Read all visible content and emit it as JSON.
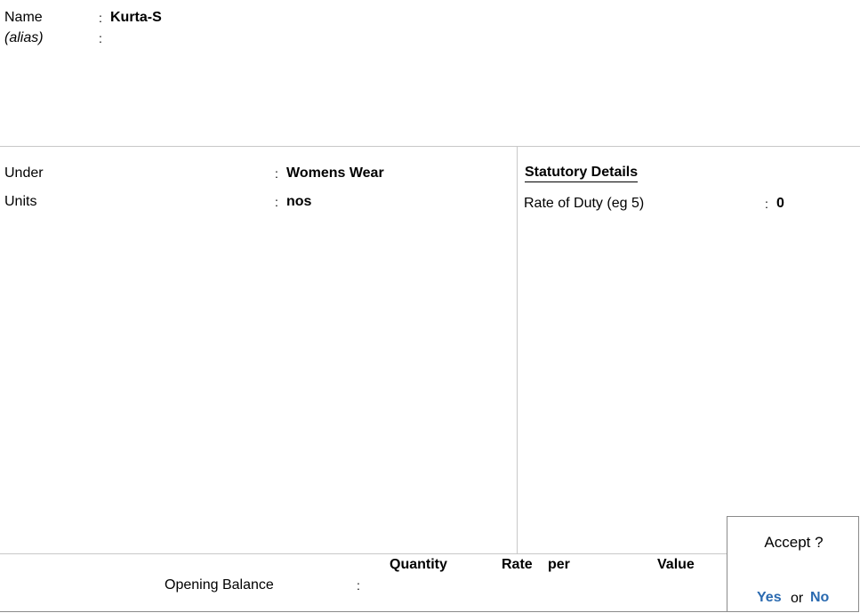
{
  "header": {
    "name_label": "Name",
    "name_colon": ":",
    "name_value": "Kurta-S",
    "alias_label": "(alias)",
    "alias_colon": ":"
  },
  "left": {
    "under_label": "Under",
    "under_colon": ":",
    "under_value": "Womens Wear",
    "units_label": "Units",
    "units_colon": ":",
    "units_value": "nos"
  },
  "statutory": {
    "title": "Statutory Details",
    "rate_label": "Rate of Duty (eg 5)",
    "rate_colon": ":",
    "rate_value": "0"
  },
  "opening": {
    "col_quantity": "Quantity",
    "col_rate": "Rate",
    "col_per": "per",
    "col_value": "Value",
    "label": "Opening Balance",
    "colon": ":"
  },
  "accept": {
    "title": "Accept ?",
    "yes": "Yes",
    "or": "or",
    "no": "No"
  }
}
